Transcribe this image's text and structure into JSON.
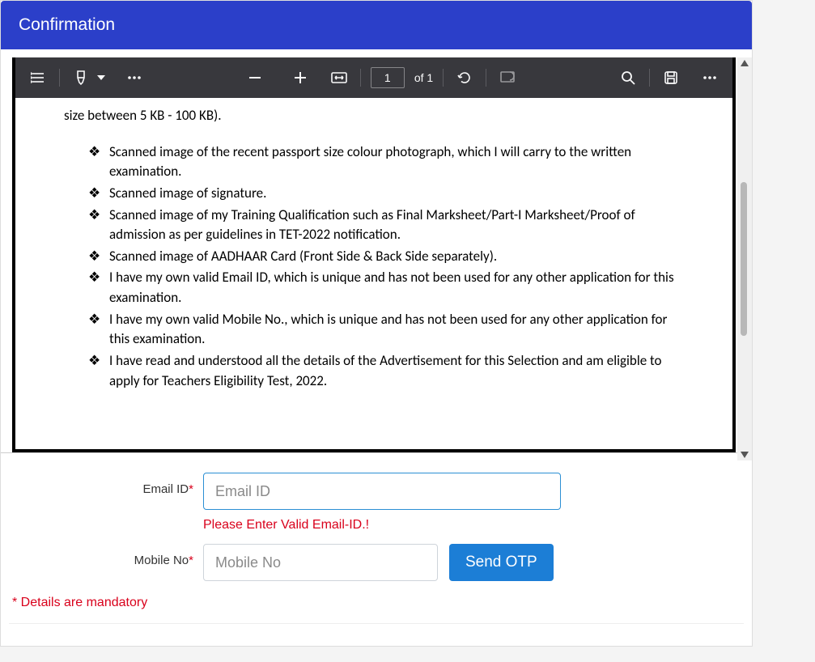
{
  "header": {
    "title": "Confirmation"
  },
  "viewer": {
    "page_current": "1",
    "page_total": "of 1"
  },
  "document": {
    "intro": "size between 5 KB - 100 KB).",
    "bullets": [
      "Scanned image of the recent passport size colour photograph, which I will carry to the written examination.",
      "Scanned image of signature.",
      "Scanned image of my Training Qualification such as Final Marksheet/Part-I Marksheet/Proof of admission as per guidelines in TET-2022 notification.",
      "Scanned image of AADHAAR Card (Front Side & Back Side separately).",
      "I have my own valid Email ID, which is unique and has not been used for any other application for this examination.",
      "I have my own valid Mobile No., which is unique and has not been used for any other application for this examination.",
      "I have read and understood all the details of the Advertisement for this Selection and am eligible to apply for Teachers Eligibility Test, 2022."
    ]
  },
  "form": {
    "email": {
      "label": "Email ID",
      "placeholder": "Email ID",
      "error": "Please Enter Valid Email-ID.!"
    },
    "mobile": {
      "label": "Mobile No",
      "placeholder": "Mobile No"
    },
    "send_otp_label": "Send OTP",
    "mandatory_note": "* Details are mandatory",
    "required_marker": "*"
  }
}
